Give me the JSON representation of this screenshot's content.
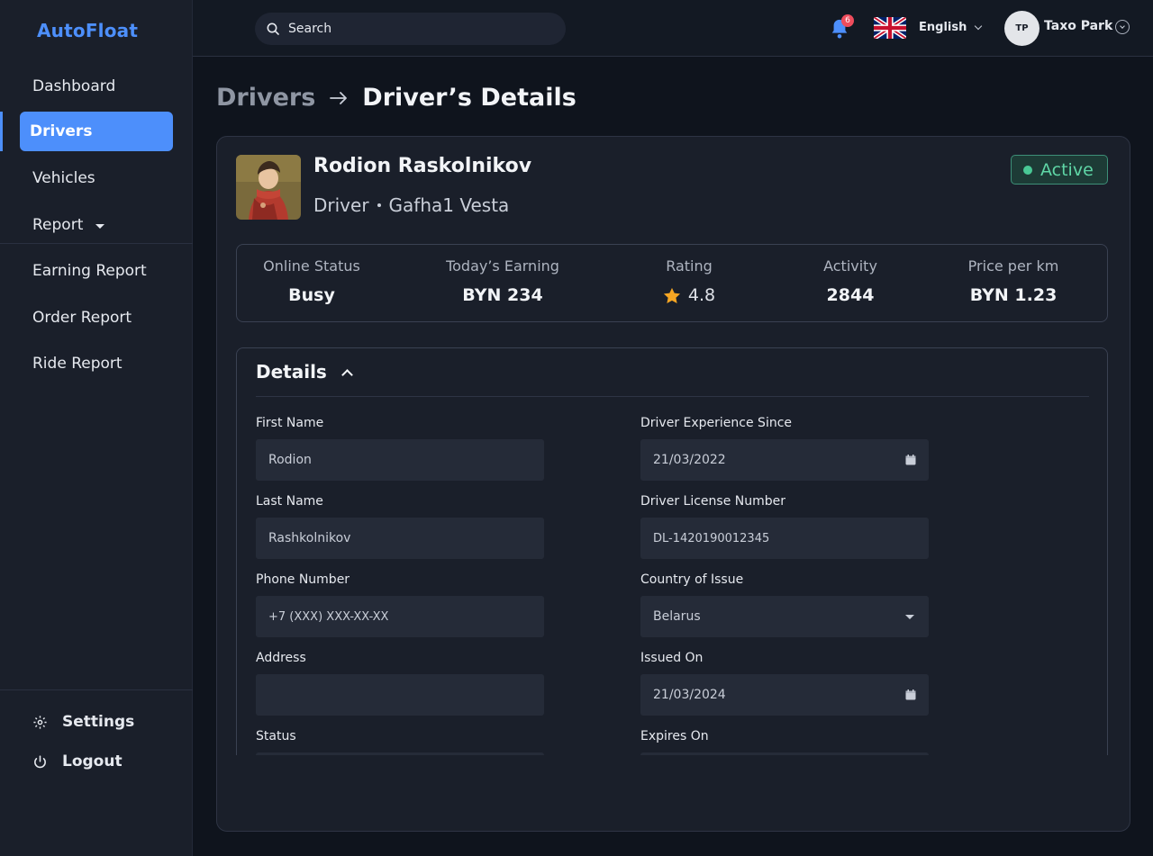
{
  "app": {
    "logo": "AutoFloat"
  },
  "sidebar": {
    "items": [
      {
        "label": "Dashboard"
      },
      {
        "label": "Drivers"
      },
      {
        "label": "Vehicles"
      },
      {
        "label": "Report"
      },
      {
        "label": "Earning Report"
      },
      {
        "label": "Order Report"
      },
      {
        "label": "Ride Report"
      }
    ],
    "settings": "Settings",
    "logout": "Logout"
  },
  "topbar": {
    "search_placeholder": "Search",
    "notification_count": "6",
    "language": "English",
    "user_initials": "TP",
    "user_name": "Taxo Park"
  },
  "breadcrumb": {
    "parent": "Drivers",
    "current": "Driver’s Details"
  },
  "driver": {
    "name": "Rodion Raskolnikov",
    "role": "Driver",
    "company": "Gafha1 Vesta",
    "status": "Active"
  },
  "stats": [
    {
      "label": "Online Status",
      "value": "Busy"
    },
    {
      "label": "Today’s Earning",
      "value": "BYN 234"
    },
    {
      "label": "Rating",
      "value": "4.8"
    },
    {
      "label": "Activity",
      "value": "2844"
    },
    {
      "label": "Price per km",
      "value": "BYN 1.23"
    }
  ],
  "details": {
    "title": "Details",
    "left": [
      {
        "label": "First Name",
        "value": "Rodion"
      },
      {
        "label": "Last Name",
        "value": "Rashkolnikov"
      },
      {
        "label": "Phone Number",
        "value": "+7 (XXX) XXX-XX-XX"
      },
      {
        "label": "Address",
        "value": ""
      },
      {
        "label": "Status",
        "value": ""
      }
    ],
    "right": [
      {
        "label": "Driver Experience Since",
        "value": "21/03/2022"
      },
      {
        "label": "Driver License Number",
        "value": "DL-1420190012345"
      },
      {
        "label": "Country of Issue",
        "value": "Belarus"
      },
      {
        "label": "Issued On",
        "value": "21/03/2024"
      },
      {
        "label": "Expires On",
        "value": ""
      }
    ]
  },
  "colors": {
    "accent": "#4d8ffb",
    "active": "#5fd6a6",
    "badge": "#ef4d5d",
    "star": "#f6a623"
  }
}
